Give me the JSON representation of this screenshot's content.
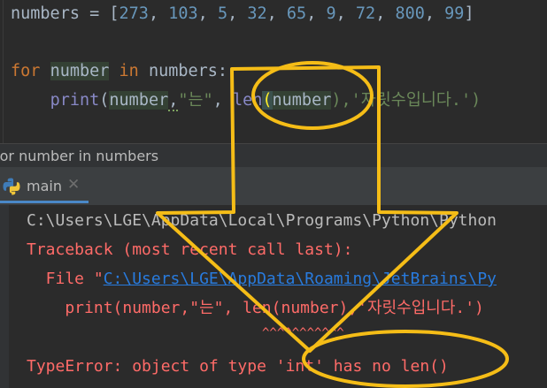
{
  "editor": {
    "line1": {
      "var": "numbers",
      "op": " = [",
      "nums": [
        "273",
        "103",
        "5",
        "32",
        "65",
        "9",
        "72",
        "800",
        "99"
      ],
      "close": "]"
    },
    "line3": {
      "kw_for": "for",
      "var": "number",
      "kw_in": "in",
      "iter": "numbers:"
    },
    "line4": {
      "fn": "print",
      "open": "(",
      "arg1": "number",
      "comma1": ",",
      "str1": "\"는\"",
      "comma2": ", ",
      "fn_len": "len",
      "len_arg": "number",
      "rest": "),'자릿수입니다.')"
    }
  },
  "breadcrumb": {
    "text": "for number in numbers"
  },
  "run": {
    "tab_label": "main",
    "console": {
      "path_line": "C:\\Users\\LGE\\AppData\\Local\\Programs\\Python\\Python",
      "traceback": "Traceback (most recent call last):",
      "file_prefix": "  File \"",
      "file_link": "C:\\Users\\LGE\\AppData\\Roaming\\JetBrains\\Py",
      "code_line": "    print(number,\"는\", len(number),'자릿수입니다.')",
      "carets": "^^^^^^^^^^^",
      "error": "TypeError: object of type 'int' has no len()"
    }
  },
  "annotation": {
    "color": "#f5bd17"
  }
}
